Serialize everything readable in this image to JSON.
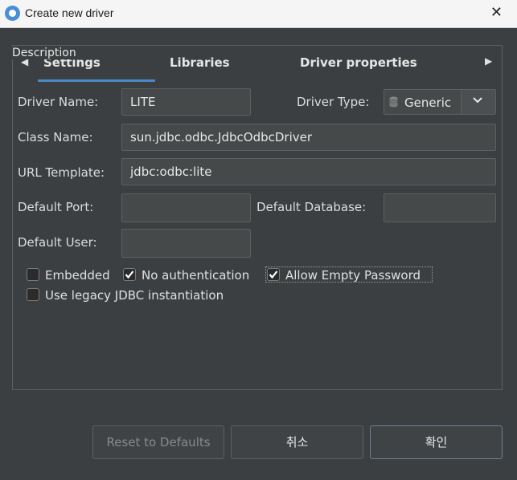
{
  "window": {
    "title": "Create new driver"
  },
  "description_label": "Description",
  "tabs": [
    {
      "label": "Settings"
    },
    {
      "label": "Libraries"
    },
    {
      "label": "Driver properties"
    }
  ],
  "form": {
    "driver_name_label": "Driver Name:",
    "driver_name_value": "LITE",
    "driver_type_label": "Driver Type:",
    "driver_type_value": "Generic",
    "class_name_label": "Class Name:",
    "class_name_value": "sun.jdbc.odbc.JdbcOdbcDriver",
    "url_template_label": "URL Template:",
    "url_template_value": "jdbc:odbc:lite",
    "default_port_label": "Default Port:",
    "default_port_value": "",
    "default_database_label": "Default Database:",
    "default_database_value": "",
    "default_user_label": "Default User:",
    "default_user_value": ""
  },
  "options": {
    "embedded": {
      "label": "Embedded",
      "checked": false
    },
    "no_auth": {
      "label": "No authentication",
      "checked": true
    },
    "allow_empty_password": {
      "label": "Allow Empty Password",
      "checked": true
    },
    "legacy_jdbc": {
      "label": "Use legacy JDBC instantiation",
      "checked": false
    }
  },
  "buttons": {
    "reset": "Reset to Defaults",
    "cancel": "취소",
    "ok": "확인"
  },
  "colors": {
    "accent": "#4a88c7",
    "background": "#3c3f41"
  }
}
